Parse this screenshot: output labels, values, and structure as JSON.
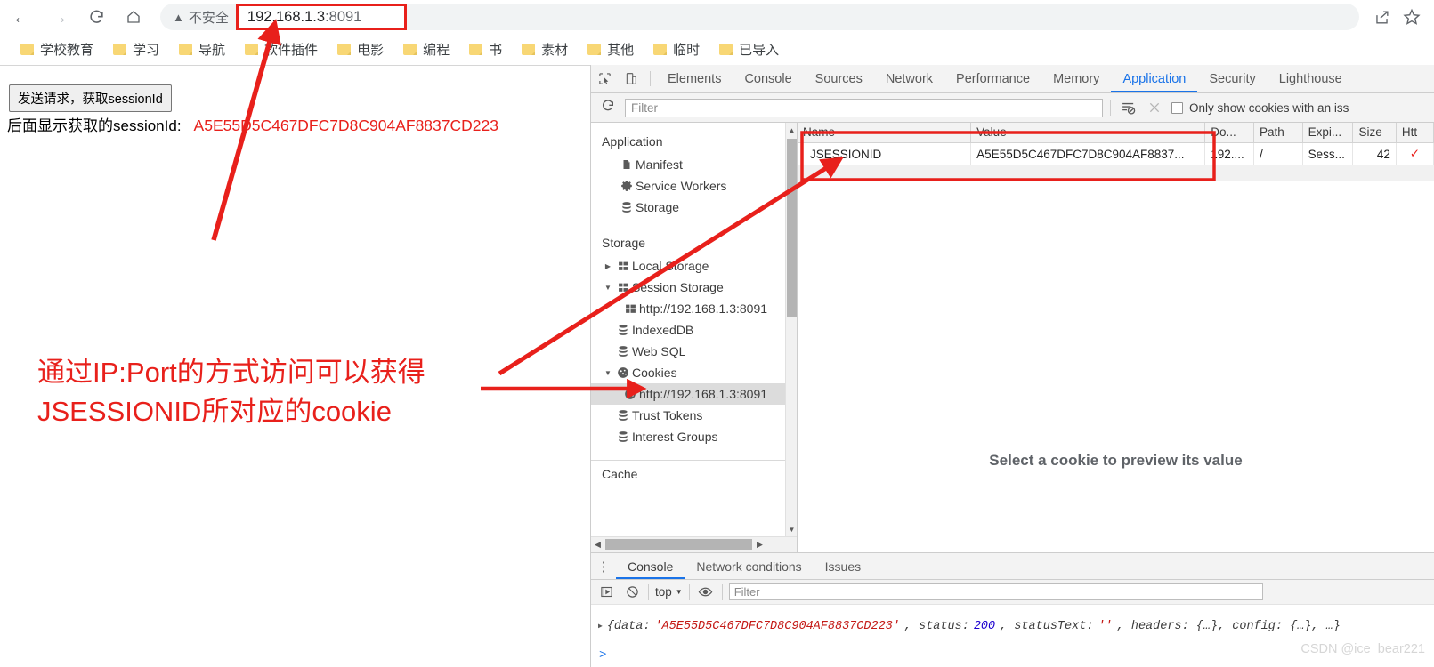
{
  "browser": {
    "nav": {
      "back": "back-arrow",
      "forward": "forward-arrow",
      "reload": "reload",
      "home": "home"
    },
    "security_label": "不安全",
    "url_host": "192.168.1.3",
    "url_port": ":8091",
    "right_icons": [
      "share-icon",
      "star-icon"
    ],
    "bookmarks": [
      "学校教育",
      "学习",
      "导航",
      "软件插件",
      "电影",
      "编程",
      "书",
      "素材",
      "其他",
      "临时",
      "已导入"
    ]
  },
  "page": {
    "button_label": "发送请求，获取sessionId",
    "session_prefix": "后面显示获取的sessionId:",
    "session_id": "A5E55D5C467DFC7D8C904AF8837CD223",
    "annotation": "通过IP:Port的方式访问可以获得\nJSESSIONID所对应的cookie",
    "annotation_color": "#e8201b"
  },
  "devtools": {
    "tabs": [
      {
        "label": "Elements",
        "active": false
      },
      {
        "label": "Console",
        "active": false
      },
      {
        "label": "Sources",
        "active": false
      },
      {
        "label": "Network",
        "active": false
      },
      {
        "label": "Performance",
        "active": false
      },
      {
        "label": "Memory",
        "active": false
      },
      {
        "label": "Application",
        "active": true
      },
      {
        "label": "Security",
        "active": false
      },
      {
        "label": "Lighthouse",
        "active": false
      }
    ],
    "toolbar": {
      "refresh_icon": "refresh-icon",
      "filter_placeholder": "Filter",
      "clear_filtered_icon": "clear-filtered-cookies-icon",
      "clear_all_icon": "clear-all-cookies-icon",
      "issue_checkbox_label": "Only show cookies with an iss",
      "issue_checked": false
    },
    "sidebar": {
      "sections": [
        {
          "title": "Application",
          "items": [
            {
              "label": "Manifest",
              "icon": "manifest-icon",
              "indent": 1,
              "twisty": "",
              "selected": false
            },
            {
              "label": "Service Workers",
              "icon": "gear-icon",
              "indent": 1,
              "twisty": "",
              "selected": false
            },
            {
              "label": "Storage",
              "icon": "database-icon",
              "indent": 1,
              "twisty": "",
              "selected": false
            }
          ]
        },
        {
          "title": "Storage",
          "items": [
            {
              "label": "Local Storage",
              "icon": "grid-icon",
              "indent": 1,
              "twisty": "collapsed",
              "selected": false
            },
            {
              "label": "Session Storage",
              "icon": "grid-icon",
              "indent": 1,
              "twisty": "expanded",
              "selected": false
            },
            {
              "label": "http://192.168.1.3:8091",
              "icon": "grid-icon",
              "indent": 2,
              "twisty": "",
              "selected": false
            },
            {
              "label": "IndexedDB",
              "icon": "database-icon",
              "indent": 1,
              "twisty": "",
              "selected": false
            },
            {
              "label": "Web SQL",
              "icon": "database-icon",
              "indent": 1,
              "twisty": "",
              "selected": false
            },
            {
              "label": "Cookies",
              "icon": "cookie-icon",
              "indent": 1,
              "twisty": "expanded",
              "selected": false
            },
            {
              "label": "http://192.168.1.3:8091",
              "icon": "cookie-icon",
              "indent": 2,
              "twisty": "",
              "selected": true
            },
            {
              "label": "Trust Tokens",
              "icon": "database-icon",
              "indent": 1,
              "twisty": "",
              "selected": false
            },
            {
              "label": "Interest Groups",
              "icon": "database-icon",
              "indent": 1,
              "twisty": "",
              "selected": false
            }
          ]
        },
        {
          "title": "Cache",
          "items": []
        }
      ]
    },
    "cookie_table": {
      "columns": [
        "Name",
        "Value",
        "Do...",
        "Path",
        "Expi...",
        "Size",
        "Htt"
      ],
      "rows": [
        {
          "name": "JSESSIONID",
          "value": "A5E55D5C467DFC7D8C904AF8837...",
          "domain": "192....",
          "path": "/",
          "expires": "Sess...",
          "size": "42",
          "httponly": "✓"
        }
      ]
    },
    "preview_message": "Select a cookie to preview its value",
    "drawer": {
      "tabs": [
        {
          "label": "Console",
          "active": true
        },
        {
          "label": "Network conditions",
          "active": false
        },
        {
          "label": "Issues",
          "active": false
        }
      ],
      "console_toolbar": {
        "execute_icon": "execute-icon",
        "clear_icon": "clear-console-icon",
        "context": "top",
        "eye_icon": "live-expression-icon",
        "filter_placeholder": "Filter"
      },
      "log_entry": {
        "prefix": "{data: ",
        "data_value": "'A5E55D5C467DFC7D8C904AF8837CD223'",
        "mid1": ", status: ",
        "status": "200",
        "mid2": ", statusText: ",
        "status_text": "''",
        "tail": ", headers: {…}, config: {…}, …}"
      },
      "prompt": ">"
    }
  },
  "watermark": "CSDN @ice_bear221"
}
